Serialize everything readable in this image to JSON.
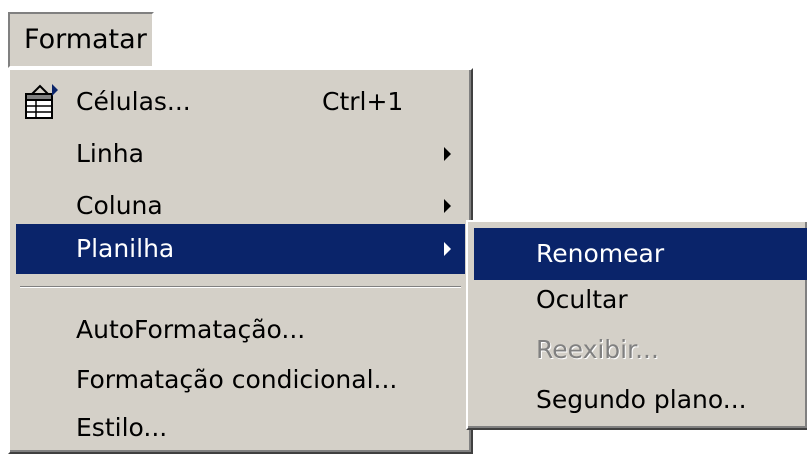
{
  "menu": {
    "title": "Formatar"
  },
  "main_menu": {
    "items": [
      {
        "label": "Células...",
        "shortcut": "Ctrl+1",
        "icon": "format-cells-icon"
      },
      {
        "label": "Linha",
        "submenu": true
      },
      {
        "label": "Coluna",
        "submenu": true
      },
      {
        "label": "Planilha",
        "submenu": true,
        "selected": true
      },
      {
        "label": "AutoFormatação..."
      },
      {
        "label": "Formatação condicional..."
      },
      {
        "label": "Estilo..."
      }
    ]
  },
  "sub_menu": {
    "items": [
      {
        "label": "Renomear",
        "selected": true
      },
      {
        "label": "Ocultar"
      },
      {
        "label": "Reexibir...",
        "disabled": true
      },
      {
        "label": "Segundo plano..."
      }
    ]
  },
  "colors": {
    "menu_background": "#d4d0c8",
    "highlight": "#0a246a",
    "highlight_text": "#ffffff",
    "disabled_text": "#808080"
  }
}
